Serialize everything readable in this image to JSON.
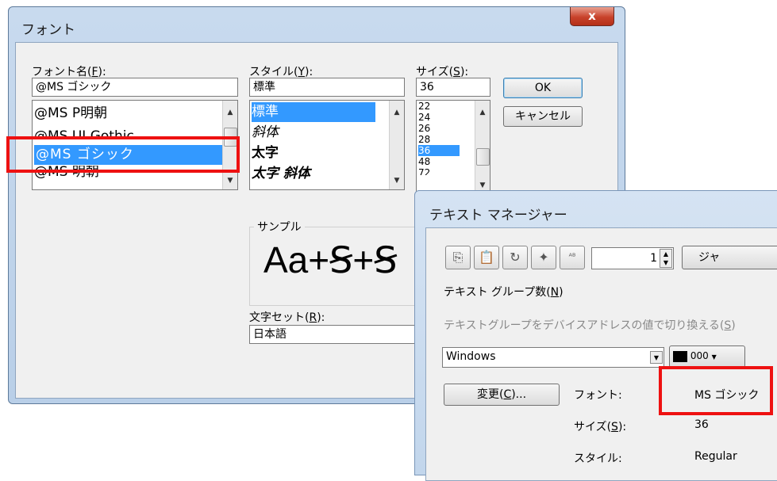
{
  "font_dialog": {
    "title": "フォント",
    "close_glyph": "x",
    "font_name_label": "フォント名(",
    "font_name_key": "F",
    "font_name_label_end": "):",
    "font_name_value": "@MS ゴシック",
    "font_list": [
      "@MS P明朝",
      "@MS UI Gothic",
      "@MS ゴシック",
      "@MS 明朝"
    ],
    "style_label": "スタイル(",
    "style_key": "Y",
    "style_label_end": "):",
    "style_value": "標準",
    "style_list": [
      "標準",
      "斜体",
      "太字",
      "太字 斜体"
    ],
    "size_label": "サイズ(",
    "size_key": "S",
    "size_label_end": "):",
    "size_value": "36",
    "size_list": [
      "22",
      "24",
      "26",
      "28",
      "36",
      "48",
      "72"
    ],
    "ok_label": "OK",
    "cancel_label": "キャンセル",
    "sample_label": "サンプル",
    "sample_text": "Aa+Ꞩ+Ꞩ",
    "charset_label": "文字セット(",
    "charset_key": "R",
    "charset_label_end": "):",
    "charset_value": "日本語"
  },
  "text_manager": {
    "title": "テキスト マネージャー",
    "number_value": "1",
    "jump_label": "ジャ",
    "group_count_label": "テキスト グループ数(",
    "group_count_key": "N",
    "group_count_label_end": ")",
    "switch_label": "テキストグループをデバイスアドレスの値で切り換える(",
    "switch_key": "S",
    "switch_label_end": ")",
    "combo_value": "Windows",
    "color_value": "000",
    "change_button": "変更(",
    "change_key": "C",
    "change_button_end": ")...",
    "font_label": "フォント:",
    "font_value": "MS ゴシック",
    "size_label": "サイズ(",
    "size_key": "S",
    "size_label_end": "):",
    "size_value": "36",
    "style_label": "スタイル:",
    "style_value": "Regular"
  },
  "colors": {
    "highlight": "#3399ff",
    "annotation": "#ee1111"
  }
}
